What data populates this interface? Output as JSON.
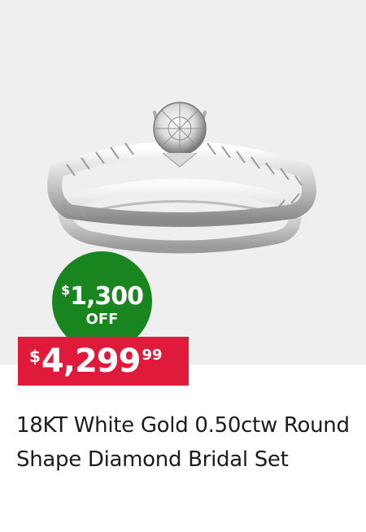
{
  "product": {
    "image_alt": "18KT White Gold 0.50ctw Round Shape Diamond Bridal Set ring image",
    "title": "18KT White Gold 0.50ctw Round Shape Diamond Bridal Set"
  },
  "savings_badge": {
    "currency": "$",
    "amount": "1,300",
    "label": "OFF",
    "color": "#18851f"
  },
  "price": {
    "currency": "$",
    "main": "4,299",
    "cents": "99",
    "color": "#e01a3a"
  }
}
